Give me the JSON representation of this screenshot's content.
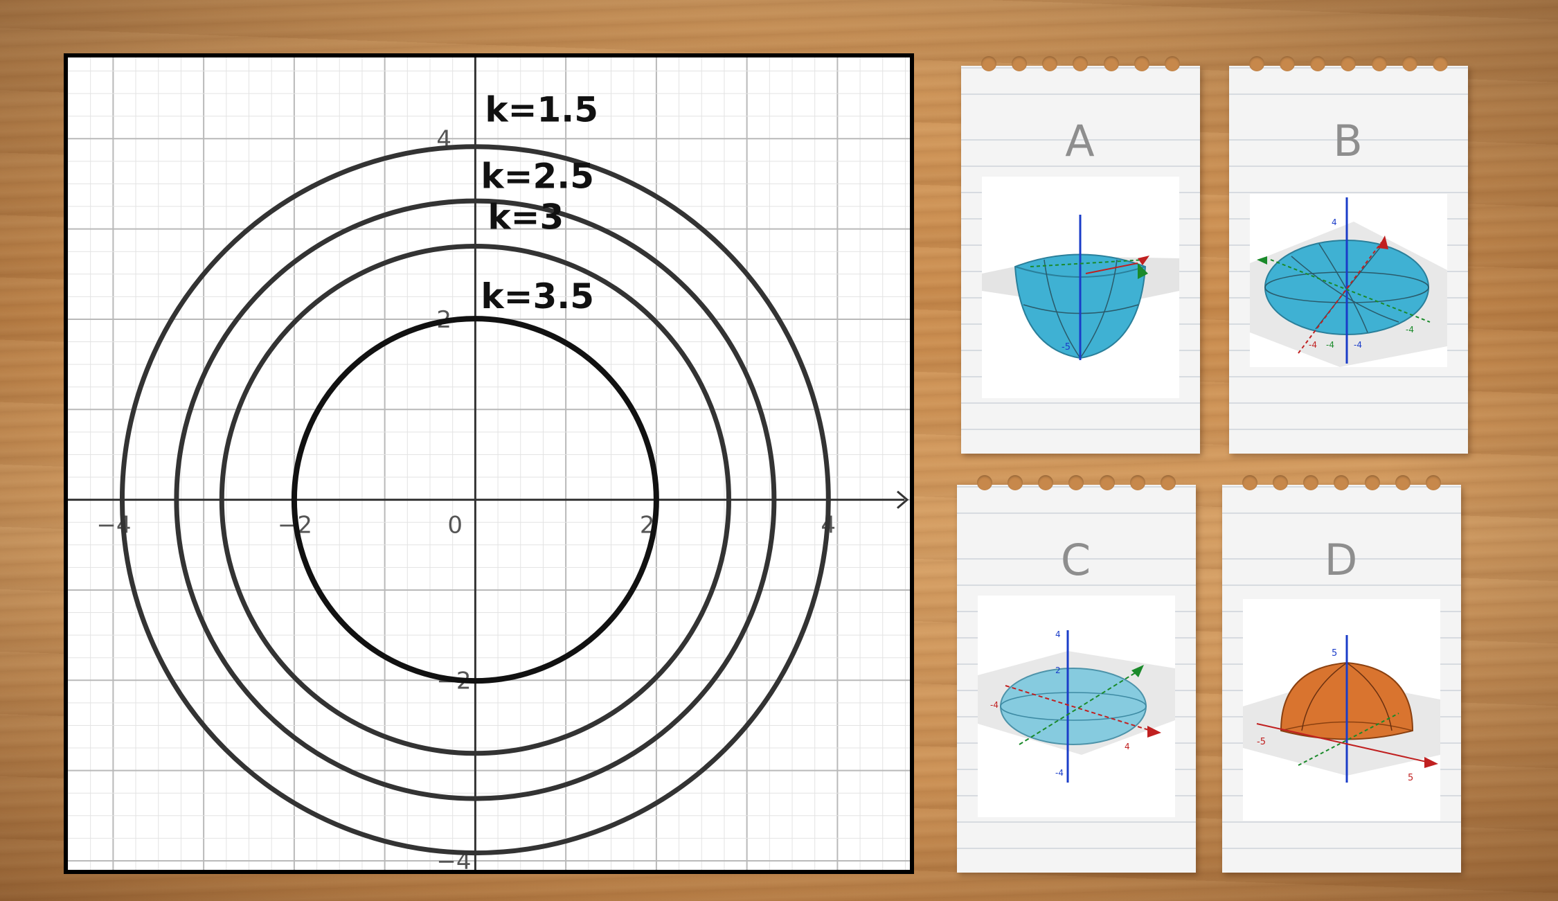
{
  "graph": {
    "x_tick_labels": [
      "−4",
      "−2",
      "0",
      "2",
      "4"
    ],
    "y_tick_labels": [
      "4",
      "2",
      "−2",
      "−4"
    ],
    "curves": [
      {
        "label": "k=1.5",
        "radius": 3.9
      },
      {
        "label": "k=2.5",
        "radius": 3.3
      },
      {
        "label": "k=3",
        "radius": 2.8
      },
      {
        "label": "k=3.5",
        "radius": 2.0
      }
    ],
    "xlim": [
      -4.5,
      4.8
    ],
    "ylim": [
      -4.1,
      4.9
    ]
  },
  "cards": [
    {
      "letter": "A",
      "surface": "lower-hemi-ellipsoid",
      "color": "#3fb1d3"
    },
    {
      "letter": "B",
      "surface": "ellipsoid",
      "color": "#3fb1d3"
    },
    {
      "letter": "C",
      "surface": "flat-ellipsoid",
      "color": "#7cc8df"
    },
    {
      "letter": "D",
      "surface": "upper-hemisphere",
      "color": "#d9742f"
    }
  ],
  "thumb_axis_labels": {
    "a": [
      "-5"
    ],
    "b": [
      "4",
      "-4",
      "-4",
      "-4",
      "-4"
    ],
    "c": [
      "4",
      "2",
      "-4",
      "-4",
      "4"
    ],
    "d": [
      "5",
      "-5",
      "5"
    ]
  }
}
